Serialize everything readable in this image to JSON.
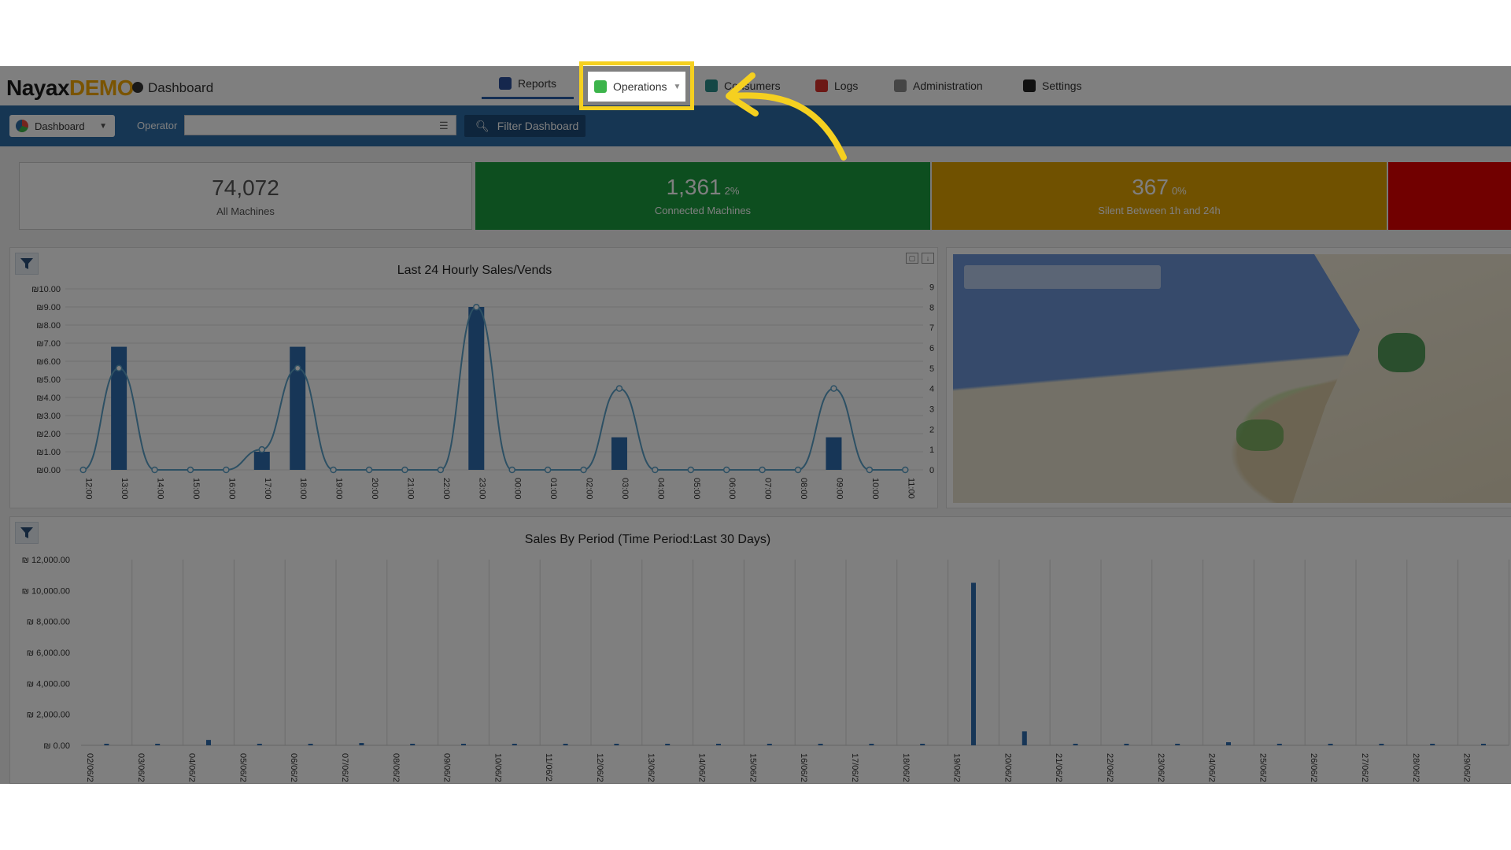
{
  "header": {
    "logo_main": "Nayax",
    "logo_demo": "DEMO",
    "breadcrumb": "Dashboard",
    "nav": [
      {
        "label": "Reports"
      },
      {
        "label": "Operations"
      },
      {
        "label": "Consumers"
      },
      {
        "label": "Logs"
      },
      {
        "label": "Administration"
      },
      {
        "label": "Settings"
      }
    ]
  },
  "toolbar": {
    "dashboard_label": "Dashboard",
    "operator_label": "Operator",
    "operator_value": "",
    "filter_label": "Filter Dashboard"
  },
  "stats": [
    {
      "value": "74,072",
      "pct": "",
      "label": "All Machines",
      "color": "#ffffff"
    },
    {
      "value": "1,361",
      "pct": "2%",
      "label": "Connected Machines",
      "color": "#1a9c3e"
    },
    {
      "value": "367",
      "pct": "0%",
      "label": "Silent Between 1h and 24h",
      "color": "#e0a200"
    },
    {
      "value": "",
      "pct": "",
      "label": "",
      "color": "#e20000"
    }
  ],
  "chart_data": [
    {
      "type": "bar",
      "title": "Last 24 Hourly Sales/Vends",
      "categories": [
        "12:00",
        "13:00",
        "14:00",
        "15:00",
        "16:00",
        "17:00",
        "18:00",
        "19:00",
        "20:00",
        "21:00",
        "22:00",
        "23:00",
        "00:00",
        "01:00",
        "02:00",
        "03:00",
        "04:00",
        "05:00",
        "06:00",
        "07:00",
        "08:00",
        "09:00",
        "10:00",
        "11:00"
      ],
      "series": [
        {
          "type": "bar",
          "axis": "left",
          "values": [
            0,
            6.8,
            0,
            0,
            0,
            1.0,
            6.8,
            0,
            0,
            0,
            0,
            9.0,
            0,
            0,
            0,
            1.8,
            0,
            0,
            0,
            0,
            0,
            1.8,
            0,
            0
          ]
        },
        {
          "type": "line",
          "axis": "right",
          "values": [
            0,
            5,
            0,
            0,
            0,
            1,
            5,
            0,
            0,
            0,
            0,
            8,
            0,
            0,
            0,
            4,
            0,
            0,
            0,
            0,
            0,
            4,
            0,
            0
          ]
        }
      ],
      "y_left_ticks": [
        "₪0.00",
        "₪1.00",
        "₪2.00",
        "₪3.00",
        "₪4.00",
        "₪5.00",
        "₪6.00",
        "₪7.00",
        "₪8.00",
        "₪9.00",
        "₪10.00"
      ],
      "y_right_ticks": [
        "0",
        "1",
        "2",
        "3",
        "4",
        "5",
        "6",
        "7",
        "8",
        "9"
      ],
      "ylim": [
        0,
        10
      ],
      "y2lim": [
        0,
        8.9
      ]
    },
    {
      "type": "bar",
      "title": "Sales By Period (Time Period:Last 30 Days)",
      "categories": [
        "02/06/2",
        "03/06/2",
        "04/06/2",
        "05/06/2",
        "06/06/2",
        "07/06/2",
        "08/06/2",
        "09/06/2",
        "10/06/2",
        "11/06/2",
        "12/06/2",
        "13/06/2",
        "14/06/2",
        "15/06/2",
        "16/06/2",
        "17/06/2",
        "18/06/2",
        "19/06/2",
        "20/06/2",
        "21/06/2",
        "22/06/2",
        "23/06/2",
        "24/06/2",
        "25/06/2",
        "26/06/2",
        "27/06/2",
        "28/06/2",
        "29/06/2"
      ],
      "values": [
        0,
        0,
        350,
        0,
        0,
        150,
        0,
        0,
        100,
        0,
        0,
        0,
        0,
        0,
        0,
        0,
        0,
        10500,
        900,
        0,
        0,
        0,
        200,
        0,
        0,
        100,
        0,
        0
      ],
      "y_ticks": [
        "₪ 0.00",
        "₪ 2,000.00",
        "₪ 4,000.00",
        "₪ 6,000.00",
        "₪ 8,000.00",
        "₪ 10,000.00",
        "₪ 12,000.00"
      ],
      "ylim": [
        0,
        12000
      ]
    }
  ],
  "colors": {
    "bar": "#2e6dae",
    "line": "#5aa0c8",
    "highlight": "#f5d020"
  }
}
